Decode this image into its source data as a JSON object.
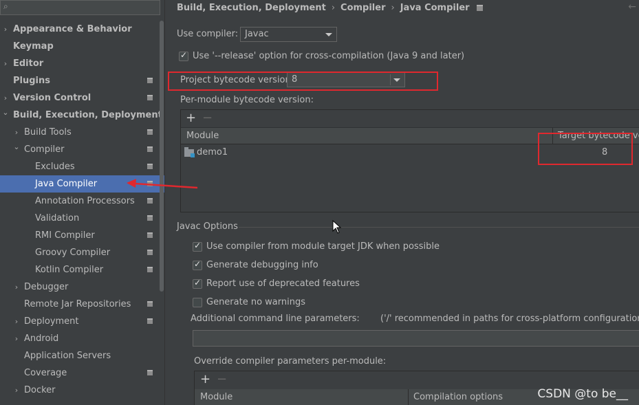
{
  "sidebar": {
    "search_placeholder": "",
    "items": [
      {
        "label": "Appearance & Behavior",
        "bold": true,
        "expandable": true,
        "expanded": false,
        "badge": false
      },
      {
        "label": "Keymap",
        "bold": true,
        "expandable": false,
        "badge": false
      },
      {
        "label": "Editor",
        "bold": true,
        "expandable": true,
        "expanded": false,
        "badge": false
      },
      {
        "label": "Plugins",
        "bold": true,
        "expandable": false,
        "badge": true
      },
      {
        "label": "Version Control",
        "bold": true,
        "expandable": true,
        "expanded": false,
        "badge": true
      },
      {
        "label": "Build, Execution, Deployment",
        "bold": true,
        "expandable": true,
        "expanded": true,
        "badge": false
      },
      {
        "label": "Build Tools",
        "bold": false,
        "expandable": true,
        "expanded": false,
        "badge": true
      },
      {
        "label": "Compiler",
        "bold": false,
        "expandable": true,
        "expanded": true,
        "badge": true
      },
      {
        "label": "Excludes",
        "bold": false,
        "expandable": false,
        "badge": true
      },
      {
        "label": "Java Compiler",
        "bold": false,
        "expandable": false,
        "badge": true,
        "selected": true
      },
      {
        "label": "Annotation Processors",
        "bold": false,
        "expandable": false,
        "badge": true
      },
      {
        "label": "Validation",
        "bold": false,
        "expandable": false,
        "badge": true
      },
      {
        "label": "RMI Compiler",
        "bold": false,
        "expandable": false,
        "badge": true
      },
      {
        "label": "Groovy Compiler",
        "bold": false,
        "expandable": false,
        "badge": true
      },
      {
        "label": "Kotlin Compiler",
        "bold": false,
        "expandable": false,
        "badge": true
      },
      {
        "label": "Debugger",
        "bold": false,
        "expandable": true,
        "expanded": false,
        "badge": false
      },
      {
        "label": "Remote Jar Repositories",
        "bold": false,
        "expandable": false,
        "badge": true
      },
      {
        "label": "Deployment",
        "bold": false,
        "expandable": true,
        "expanded": false,
        "badge": true
      },
      {
        "label": "Android",
        "bold": false,
        "expandable": true,
        "expanded": false,
        "badge": false
      },
      {
        "label": "Application Servers",
        "bold": false,
        "expandable": false,
        "badge": false
      },
      {
        "label": "Coverage",
        "bold": false,
        "expandable": false,
        "badge": true
      },
      {
        "label": "Docker",
        "bold": false,
        "expandable": true,
        "expanded": false,
        "badge": false
      }
    ]
  },
  "breadcrumb": {
    "part1": "Build, Execution, Deployment",
    "part2": "Compiler",
    "part3": "Java Compiler",
    "separator": "›"
  },
  "compiler": {
    "use_compiler_label": "Use compiler:",
    "use_compiler_value": "Javac",
    "release_option_label": "Use '--release' option for cross-compilation (Java 9 and later)",
    "release_option_checked": true,
    "project_bytecode_label": "Project bytecode version:",
    "project_bytecode_value": "8",
    "per_module_label": "Per-module bytecode version:"
  },
  "module_table": {
    "add_label": "+",
    "remove_label": "−",
    "col_module": "Module",
    "col_target": "Target bytecode ver",
    "rows": [
      {
        "module": "demo1",
        "target": "8"
      }
    ]
  },
  "javac_options": {
    "title": "Javac Options",
    "checkboxes": [
      {
        "label": "Use compiler from module target JDK when possible",
        "checked": true
      },
      {
        "label": "Generate debugging info",
        "checked": true
      },
      {
        "label": "Report use of deprecated features",
        "checked": true
      },
      {
        "label": "Generate no warnings",
        "checked": false
      }
    ],
    "additional_params_label": "Additional command line parameters:",
    "additional_params_hint": "('/' recommended in paths for cross-platform configurations)",
    "additional_params_value": "",
    "override_label": "Override compiler parameters per-module:"
  },
  "override_table": {
    "add_label": "+",
    "remove_label": "−",
    "col_module": "Module",
    "col_options": "Compilation options"
  },
  "watermark": "CSDN @to be__",
  "colors": {
    "background": "#3c3f41",
    "selection": "#4b6eaf",
    "annotation_red": "#e0282e",
    "text": "#bbbbbb"
  }
}
